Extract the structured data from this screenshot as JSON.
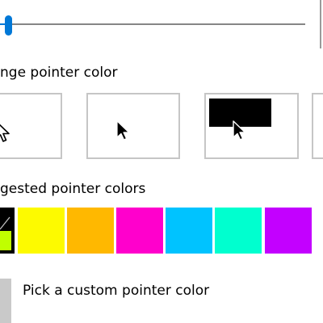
{
  "change_pointer_color": {
    "heading": "nge pointer color",
    "styles": [
      {
        "icon": "white-arrow-pointer-icon"
      },
      {
        "icon": "black-arrow-pointer-icon"
      },
      {
        "icon": "inverted-arrow-pointer-icon"
      }
    ]
  },
  "suggested_colors": {
    "heading": "gested pointer colors",
    "colors": [
      "#fdfa00",
      "#ffb800",
      "#ff00cc",
      "#00c3ff",
      "#00ffcf",
      "#c300ff"
    ],
    "custom_swatch_colors": [
      "#000000",
      "#c0ff00"
    ]
  },
  "custom_color": {
    "label": "Pick a custom pointer color"
  }
}
